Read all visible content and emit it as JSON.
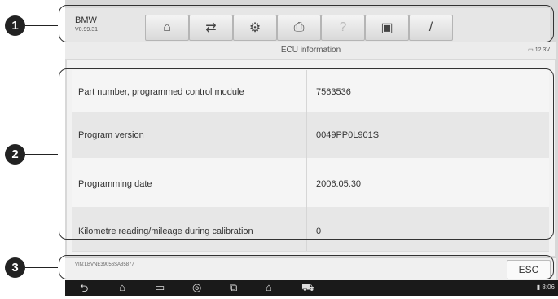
{
  "callouts": [
    "1",
    "2",
    "3"
  ],
  "toolbar": {
    "brand": "BMW",
    "version": "V0.99.31",
    "buttons": [
      {
        "icon": "home-icon",
        "glyph": "⌂"
      },
      {
        "icon": "vehicle-swap-icon",
        "glyph": "⇄"
      },
      {
        "icon": "settings-gear-icon",
        "glyph": "⚙"
      },
      {
        "icon": "print-icon",
        "glyph": "⎙"
      },
      {
        "icon": "help-icon",
        "glyph": "?"
      },
      {
        "icon": "save-icon",
        "glyph": "▣"
      },
      {
        "icon": "edit-pen-icon",
        "glyph": "/"
      }
    ]
  },
  "title_bar": {
    "title": "ECU information",
    "battery": "12.3V"
  },
  "rows": [
    {
      "name": "Part number, programmed control module",
      "value": "7563536"
    },
    {
      "name": "Program version",
      "value": "0049PP0L901S"
    },
    {
      "name": "Programming date",
      "value": "2006.05.30"
    },
    {
      "name": "Kilometre reading/mileage during calibration",
      "value": "0"
    }
  ],
  "footer": {
    "vin": "VIN:LBVNE39056SA85877",
    "esc_label": "ESC"
  },
  "navbar": {
    "icons": [
      "back-icon",
      "home-icon",
      "recent-apps-icon",
      "chrome-icon",
      "screenshot-icon",
      "autel-home-icon",
      "vci-car-icon"
    ],
    "time": "8:06"
  }
}
